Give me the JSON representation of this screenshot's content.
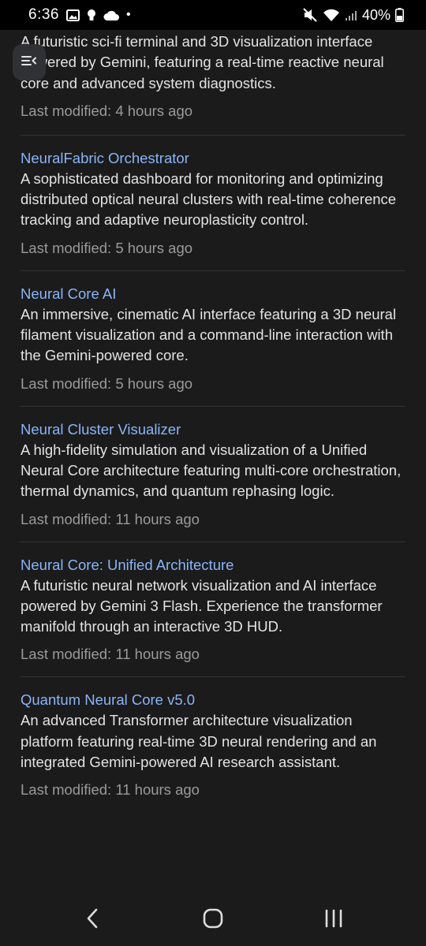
{
  "status_bar": {
    "time": "6:36",
    "battery": "40%",
    "dot": "•"
  },
  "colors": {
    "background": "#1b1b1b",
    "title": "#8ab4f8",
    "text": "#e3e3e3",
    "meta": "#9a9a9a",
    "divider": "#333333"
  },
  "menu_button": {
    "icon": "menu-collapse-icon"
  },
  "items": [
    {
      "title": "",
      "description": "A futuristic sci-fi terminal and 3D visualization interface powered by Gemini, featuring a real-time reactive neural core and advanced system diagnostics.",
      "modified": "Last modified: 4 hours ago"
    },
    {
      "title": "NeuralFabric Orchestrator",
      "description": "A sophisticated dashboard for monitoring and optimizing distributed optical neural clusters with real-time coherence tracking and adaptive neuroplasticity control.",
      "modified": "Last modified: 5 hours ago"
    },
    {
      "title": "Neural Core AI",
      "description": "An immersive, cinematic AI interface featuring a 3D neural filament visualization and a command-line interaction with the Gemini-powered core.",
      "modified": "Last modified: 5 hours ago"
    },
    {
      "title": "Neural Cluster Visualizer",
      "description": "A high-fidelity simulation and visualization of a Unified Neural Core architecture featuring multi-core orchestration, thermal dynamics, and quantum rephasing logic.",
      "modified": "Last modified: 11 hours ago"
    },
    {
      "title": "Neural Core: Unified Architecture",
      "description": "A futuristic neural network visualization and AI interface powered by Gemini 3 Flash. Experience the transformer manifold through an interactive 3D HUD.",
      "modified": "Last modified: 11 hours ago"
    },
    {
      "title": "Quantum Neural Core v5.0",
      "description": "An advanced Transformer architecture visualization platform featuring real-time 3D neural rendering and an integrated Gemini-powered AI research assistant.",
      "modified": "Last modified: 11 hours ago"
    }
  ],
  "nav_bar": {
    "back_icon": "back-icon",
    "home_icon": "home-icon",
    "recents_icon": "recents-icon"
  }
}
